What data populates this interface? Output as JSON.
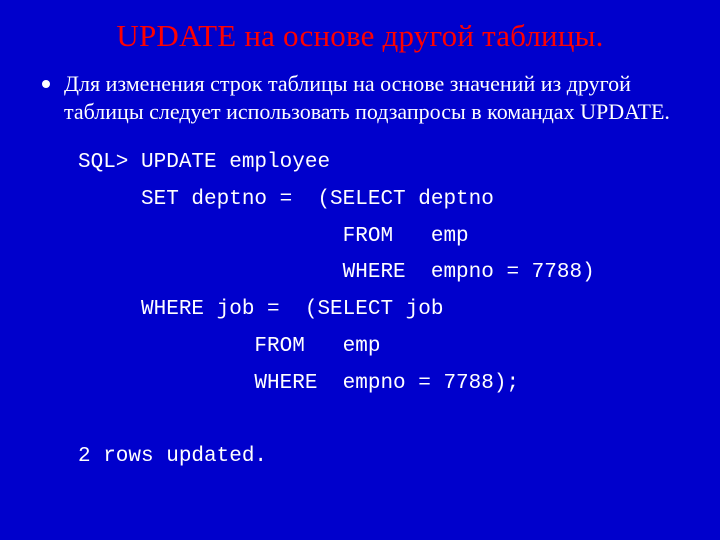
{
  "title": "UPDATE на основе другой таблицы.",
  "bullet": "Для изменения строк таблицы на основе значений из другой таблицы следует использовать подзапросы в командах UPDATE.",
  "code": "SQL> UPDATE employee\n     SET deptno =  (SELECT deptno\n                     FROM   emp\n                     WHERE  empno = 7788)\n     WHERE job =  (SELECT job\n              FROM   emp\n              WHERE  empno = 7788);\n\n2 rows updated."
}
